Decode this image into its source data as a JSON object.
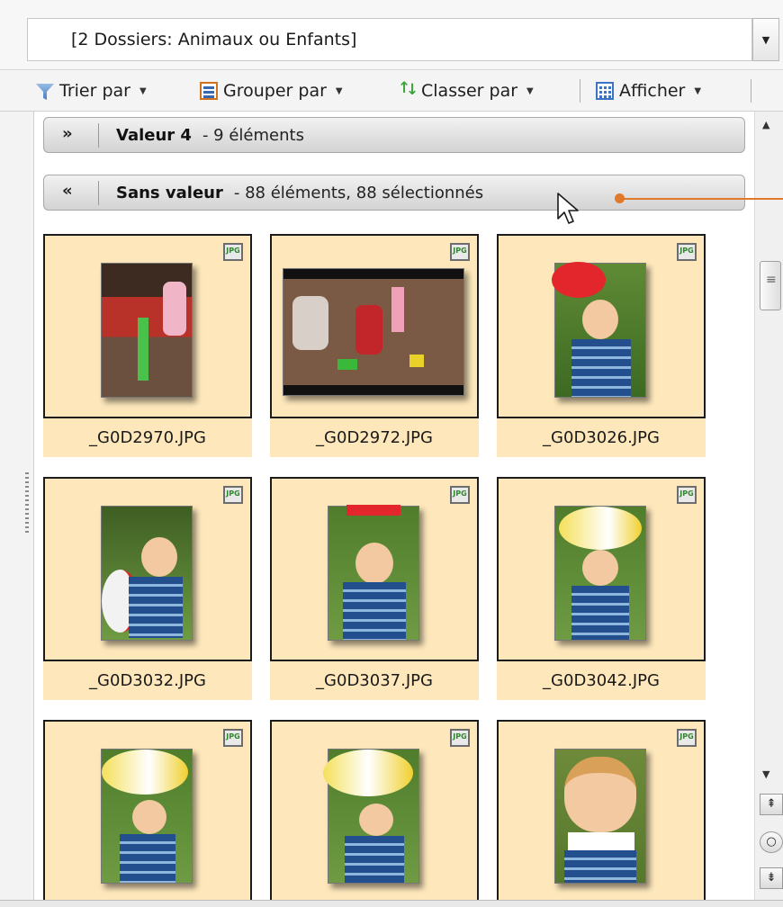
{
  "pathbar": {
    "value": "[2 Dossiers: Animaux ou Enfants]"
  },
  "toolbar": {
    "sort_label": "Trier par",
    "group_label": "Grouper par",
    "arrange_label": "Classer par",
    "view_label": "Afficher"
  },
  "groups": [
    {
      "title": "Valeur 4",
      "count": "- 9 éléments",
      "state": "collapsed"
    },
    {
      "title": "Sans valeur",
      "count": "- 88 éléments, 88 sélectionnés",
      "state": "expanded"
    }
  ],
  "files": [
    {
      "name": "_G0D2970.JPG",
      "badge": "JPG"
    },
    {
      "name": "_G0D2972.JPG",
      "badge": "JPG"
    },
    {
      "name": "_G0D3026.JPG",
      "badge": "JPG"
    },
    {
      "name": "_G0D3032.JPG",
      "badge": "JPG"
    },
    {
      "name": "_G0D3037.JPG",
      "badge": "JPG"
    },
    {
      "name": "_G0D3042.JPG",
      "badge": "JPG"
    },
    {
      "name": "",
      "badge": "JPG"
    },
    {
      "name": "",
      "badge": "JPG"
    },
    {
      "name": "",
      "badge": "JPG"
    }
  ],
  "colors": {
    "tile_fill": "#fde7bb",
    "accent_callout": "#e07a2a"
  }
}
